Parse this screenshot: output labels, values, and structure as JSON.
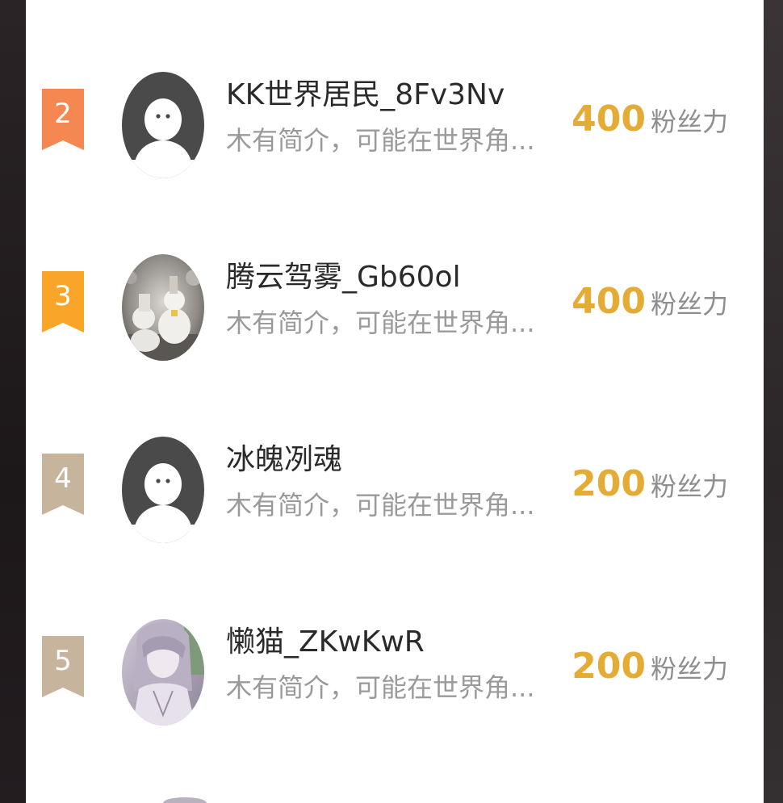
{
  "colors": {
    "rank_2": "#f58750",
    "rank_3": "#f9a528",
    "rank_other": "#c7b49d",
    "fans_count": "#e4ab35",
    "fans_unit": "#8e8e8e",
    "name": "#2a2a2a",
    "bio": "#9a9a9a"
  },
  "entries": [
    {
      "rank": "2",
      "name": "KK世界居民_8Fv3Nv",
      "bio": "木有简介，可能在世界角...",
      "fans_count": "400",
      "fans_unit": "粉丝力",
      "avatar": "default-avatar-icon"
    },
    {
      "rank": "3",
      "name": "腾云驾雾_Gb60ol",
      "bio": "木有简介，可能在世界角...",
      "fans_count": "400",
      "fans_unit": "粉丝力",
      "avatar": "snowman-photo"
    },
    {
      "rank": "4",
      "name": "冰魄冽魂",
      "bio": "木有简介，可能在世界角...",
      "fans_count": "200",
      "fans_unit": "粉丝力",
      "avatar": "default-avatar-icon"
    },
    {
      "rank": "5",
      "name": "懒猫_ZKwKwR",
      "bio": "木有简介，可能在世界角...",
      "fans_count": "200",
      "fans_unit": "粉丝力",
      "avatar": "anime-character-photo"
    }
  ]
}
